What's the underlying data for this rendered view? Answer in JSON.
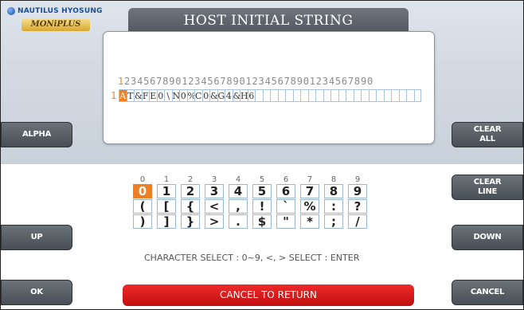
{
  "logo": {
    "brand": "NAUTILUS HYOSUNG",
    "product": "MONiPLUS"
  },
  "title": "HOST INITIAL STRING",
  "editor": {
    "ruler_first": "1",
    "ruler_rest": "234567890123456789012345678901234567890",
    "line_number": "1",
    "cells": [
      "A",
      "T",
      "&",
      "F",
      "E",
      "0",
      "\\",
      "N",
      "0",
      "%",
      "C",
      "0",
      "&",
      "G",
      "4",
      "&",
      "H",
      "6",
      "",
      "",
      "",
      "",
      "",
      "",
      "",
      "",
      "",
      "",
      "",
      "",
      "",
      "",
      "",
      "",
      "",
      "",
      "",
      "",
      "",
      ""
    ],
    "cursor_index": 0
  },
  "buttons": {
    "alpha": "ALPHA",
    "up": "UP",
    "ok": "OK",
    "clear_all": "CLEAR ALL",
    "clear_line": "CLEAR LINE",
    "down": "DOWN",
    "cancel": "CANCEL",
    "cancel_to_return": "CANCEL TO RETURN"
  },
  "keyboard": {
    "columns": [
      "0",
      "1",
      "2",
      "3",
      "4",
      "5",
      "6",
      "7",
      "8",
      "9"
    ],
    "rows": [
      [
        "0",
        "1",
        "2",
        "3",
        "4",
        "5",
        "6",
        "7",
        "8",
        "9"
      ],
      [
        "(",
        "[",
        "{",
        "<",
        ",",
        "!",
        "`",
        "%",
        ":",
        "?"
      ],
      [
        ")",
        "]",
        "}",
        ">",
        ".",
        "$",
        "\"",
        "*",
        ";",
        "/"
      ]
    ],
    "selected": {
      "row": 0,
      "col": 0
    }
  },
  "hint": "CHARACTER SELECT : 0~9, <, >  SELECT : ENTER",
  "colors": {
    "accent": "#f07e22",
    "cancel_red": "#d71818",
    "button_gray": "#5a6167"
  }
}
